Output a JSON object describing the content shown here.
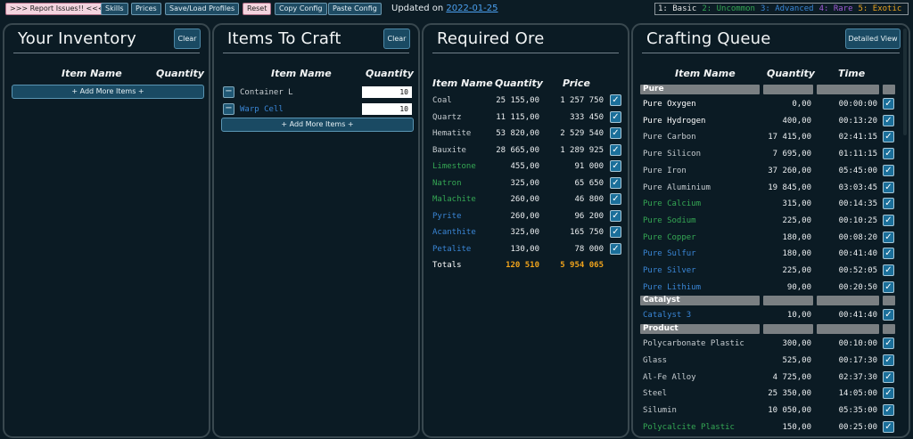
{
  "colors": {
    "basic": "#e4e4e4",
    "uncommon": "#35a854",
    "advanced": "#3a86d6",
    "rare": "#a05ad6",
    "exotic": "#e8a21e",
    "totals": "#f0a31c",
    "checkbox": "#1b6f9a",
    "section": "#7a7f82"
  },
  "topbar": {
    "report": ">>> Report Issues!! <<<",
    "skills": "Skills",
    "prices": "Prices",
    "profiles": "Save/Load Profiles",
    "reset": "Reset",
    "copy": "Copy Config",
    "paste": "Paste Config",
    "updated": "Updated on",
    "date": "2022-01-25"
  },
  "legend": [
    {
      "text": "1: Basic",
      "tier": "basic"
    },
    {
      "text": "2: Uncommon",
      "tier": "uncommon"
    },
    {
      "text": "3: Advanced",
      "tier": "advanced"
    },
    {
      "text": "4: Rare",
      "tier": "rare"
    },
    {
      "text": "5: Exotic",
      "tier": "exotic"
    }
  ],
  "inventory": {
    "title": "Your Inventory",
    "clear": "Clear",
    "col_name": "Item Name",
    "col_qty": "Quantity",
    "add": "+ Add More Items +"
  },
  "craft": {
    "title": "Items To Craft",
    "clear": "Clear",
    "col_name": "Item Name",
    "col_qty": "Quantity",
    "add": "+ Add More Items +",
    "items": [
      {
        "name": "Container L",
        "qty": "10",
        "tier": "basic"
      },
      {
        "name": "Warp Cell",
        "qty": "10",
        "tier": "advanced"
      }
    ]
  },
  "ore": {
    "title": "Required Ore",
    "col_name": "Item Name",
    "col_qty": "Quantity",
    "col_price": "Price",
    "rows": [
      {
        "name": "Coal",
        "qty": "25 155,00",
        "price": "1 257 750",
        "tier": "basic"
      },
      {
        "name": "Quartz",
        "qty": "11 115,00",
        "price": "333 450",
        "tier": "basic"
      },
      {
        "name": "Hematite",
        "qty": "53 820,00",
        "price": "2 529 540",
        "tier": "basic"
      },
      {
        "name": "Bauxite",
        "qty": "28 665,00",
        "price": "1 289 925",
        "tier": "basic"
      },
      {
        "name": "Limestone",
        "qty": "455,00",
        "price": "91 000",
        "tier": "uncommon"
      },
      {
        "name": "Natron",
        "qty": "325,00",
        "price": "65 650",
        "tier": "uncommon"
      },
      {
        "name": "Malachite",
        "qty": "260,00",
        "price": "46 800",
        "tier": "uncommon"
      },
      {
        "name": "Pyrite",
        "qty": "260,00",
        "price": "96 200",
        "tier": "advanced"
      },
      {
        "name": "Acanthite",
        "qty": "325,00",
        "price": "165 750",
        "tier": "advanced"
      },
      {
        "name": "Petalite",
        "qty": "130,00",
        "price": "78 000",
        "tier": "advanced"
      }
    ],
    "totals_label": "Totals",
    "totals_qty": "120 510",
    "totals_price": "5 954 065"
  },
  "queue": {
    "title": "Crafting Queue",
    "detailed": "Detailed View",
    "col_name": "Item Name",
    "col_qty": "Quantity",
    "col_time": "Time",
    "sections": [
      {
        "label": "Pure",
        "rows": [
          {
            "name": "Pure Oxygen",
            "qty": "0,00",
            "time": "00:00:00",
            "tier": "basic"
          },
          {
            "name": "Pure Hydrogen",
            "qty": "400,00",
            "time": "00:13:20",
            "tier": "basic"
          },
          {
            "name": "Pure Carbon",
            "qty": "17 415,00",
            "time": "02:41:15",
            "tier": "basic"
          },
          {
            "name": "Pure Silicon",
            "qty": "7 695,00",
            "time": "01:11:15",
            "tier": "basic"
          },
          {
            "name": "Pure Iron",
            "qty": "37 260,00",
            "time": "05:45:00",
            "tier": "basic"
          },
          {
            "name": "Pure Aluminium",
            "qty": "19 845,00",
            "time": "03:03:45",
            "tier": "basic"
          },
          {
            "name": "Pure Calcium",
            "qty": "315,00",
            "time": "00:14:35",
            "tier": "uncommon"
          },
          {
            "name": "Pure Sodium",
            "qty": "225,00",
            "time": "00:10:25",
            "tier": "uncommon"
          },
          {
            "name": "Pure Copper",
            "qty": "180,00",
            "time": "00:08:20",
            "tier": "uncommon"
          },
          {
            "name": "Pure Sulfur",
            "qty": "180,00",
            "time": "00:41:40",
            "tier": "advanced"
          },
          {
            "name": "Pure Silver",
            "qty": "225,00",
            "time": "00:52:05",
            "tier": "advanced"
          },
          {
            "name": "Pure Lithium",
            "qty": "90,00",
            "time": "00:20:50",
            "tier": "advanced"
          }
        ]
      },
      {
        "label": "Catalyst",
        "rows": [
          {
            "name": "Catalyst 3",
            "qty": "10,00",
            "time": "00:41:40",
            "tier": "advanced"
          }
        ]
      },
      {
        "label": "Product",
        "rows": [
          {
            "name": "Polycarbonate Plastic",
            "qty": "300,00",
            "time": "00:10:00",
            "tier": "basic"
          },
          {
            "name": "Glass",
            "qty": "525,00",
            "time": "00:17:30",
            "tier": "basic"
          },
          {
            "name": "Al-Fe Alloy",
            "qty": "4 725,00",
            "time": "02:37:30",
            "tier": "basic"
          },
          {
            "name": "Steel",
            "qty": "25 350,00",
            "time": "14:05:00",
            "tier": "basic"
          },
          {
            "name": "Silumin",
            "qty": "10 050,00",
            "time": "05:35:00",
            "tier": "basic"
          },
          {
            "name": "Polycalcite Plastic",
            "qty": "150,00",
            "time": "00:25:00",
            "tier": "uncommon"
          }
        ]
      }
    ]
  }
}
